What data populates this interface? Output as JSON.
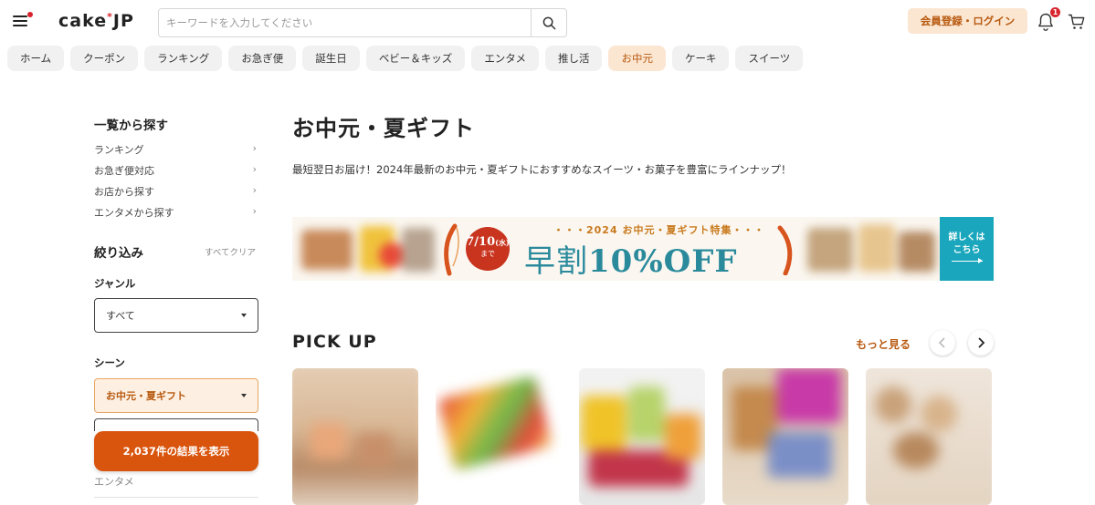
{
  "header": {
    "logo_text": "cake",
    "logo_star": "*",
    "logo_suffix": "JP",
    "search_placeholder": "キーワードを入力してください",
    "login_label": "会員登録・ログイン",
    "notification_count": "1"
  },
  "categories": [
    {
      "label": "ホーム",
      "active": false
    },
    {
      "label": "クーポン",
      "active": false
    },
    {
      "label": "ランキング",
      "active": false
    },
    {
      "label": "お急ぎ便",
      "active": false
    },
    {
      "label": "誕生日",
      "active": false
    },
    {
      "label": "ベビー＆キッズ",
      "active": false
    },
    {
      "label": "エンタメ",
      "active": false
    },
    {
      "label": "推し活",
      "active": false
    },
    {
      "label": "お中元",
      "active": true
    },
    {
      "label": "ケーキ",
      "active": false
    },
    {
      "label": "スイーツ",
      "active": false
    }
  ],
  "sidebar": {
    "browse_title": "一覧から探す",
    "browse_links": [
      "ランキング",
      "お急ぎ便対応",
      "お店から探す",
      "エンタメから探す"
    ],
    "filter_title": "絞り込み",
    "clear_all": "すべてクリア",
    "genre_label": "ジャンル",
    "genre_value": "すべて",
    "scene_label": "シーン",
    "scene_value": "お中元・夏ギフト",
    "result_button": "2,037件の結果を表示",
    "faded_label": "エンタメ"
  },
  "main": {
    "title": "お中元・夏ギフト",
    "description": "最短翌日お届け！2024年最新のお中元・夏ギフトにおすすめなスイーツ・お菓子を豊富にラインナップ！",
    "banner": {
      "date": "7/10",
      "date_suffix": "(水)",
      "date_until": "まで",
      "top_text": "・・・2024 お中元・夏ギフト特集・・・",
      "headline": "早割",
      "discount": "10%OFF",
      "detail_line1": "詳しくは",
      "detail_line2": "こちら"
    },
    "pickup_title": "PICK UP",
    "more_label": "もっと見る"
  },
  "colors": {
    "accent": "#d9540c",
    "accent_light": "#fbe6d2",
    "accent_text": "#b85a10",
    "banner_teal": "#2a8a9c",
    "badge_red": "#d8242e"
  },
  "icons": [
    "menu-icon",
    "search-icon",
    "bell-icon",
    "cart-icon",
    "chevron-right-icon",
    "chevron-left-icon",
    "caret-down-icon"
  ]
}
